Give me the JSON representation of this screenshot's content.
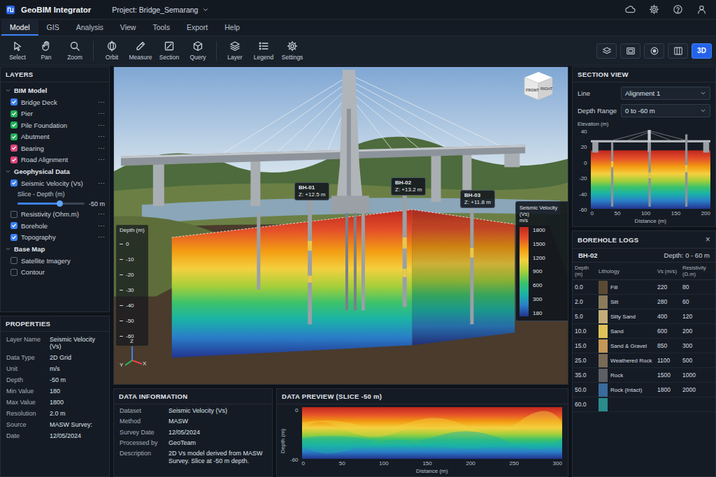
{
  "window": {
    "app_name": "GeoBIM Integrator",
    "project": "Project: Bridge_Semarang"
  },
  "menu": [
    {
      "label": "Model",
      "selected": true
    },
    {
      "label": "GIS",
      "selected": false
    },
    {
      "label": "Analysis",
      "selected": false
    },
    {
      "label": "View",
      "selected": false
    },
    {
      "label": "Tools",
      "selected": false
    },
    {
      "label": "Export",
      "selected": false
    },
    {
      "label": "Help",
      "selected": false
    }
  ],
  "toolbar": [
    [
      {
        "label": "Select",
        "kind": "select"
      },
      {
        "label": "Pan",
        "kind": "pan"
      },
      {
        "label": "Zoom",
        "kind": "zoom"
      }
    ],
    [
      {
        "label": "Orbit",
        "kind": "orbit"
      },
      {
        "label": "Measure",
        "kind": "measure"
      },
      {
        "label": "Section",
        "kind": "section"
      },
      {
        "label": "Query",
        "kind": "query"
      }
    ],
    [
      {
        "label": "Layer",
        "kind": "layer"
      },
      {
        "label": "Legend",
        "kind": "legend"
      },
      {
        "label": "Settings",
        "kind": "settings"
      }
    ]
  ],
  "view_modes": [
    {
      "kind": "layers",
      "selected": false
    },
    {
      "kind": "frame",
      "selected": false
    },
    {
      "kind": "target",
      "selected": false
    },
    {
      "kind": "split",
      "selected": false
    },
    {
      "kind": "text",
      "label": "3D",
      "selected": true
    }
  ],
  "layers": {
    "title": "LAYERS",
    "groups": [
      {
        "title": "BIM Model",
        "expanded": true,
        "items": [
          {
            "kind": "checkbox",
            "label": "Bridge Deck",
            "checked": true,
            "color": "#3b82f6",
            "more": "⋯"
          },
          {
            "kind": "checkbox",
            "label": "Pier",
            "checked": true,
            "color": "#22b05a",
            "more": "⋯"
          },
          {
            "kind": "checkbox",
            "label": "Pile Foundation",
            "checked": true,
            "color": "#22b05a",
            "more": "⋯"
          },
          {
            "kind": "checkbox",
            "label": "Abutment",
            "checked": true,
            "color": "#22b05a",
            "more": "⋯"
          },
          {
            "kind": "checkbox",
            "label": "Bearing",
            "checked": true,
            "color": "#e0457b",
            "more": "⋯"
          },
          {
            "kind": "checkbox",
            "label": "Road Alignment",
            "checked": true,
            "color": "#e0457b",
            "more": "⋯"
          }
        ]
      },
      {
        "title": "Geophysical Data",
        "expanded": true,
        "items": [
          {
            "kind": "checkbox",
            "label": "Seismic Velocity (Vs)",
            "checked": true,
            "color": "#3b82f6",
            "more": "⋯"
          },
          {
            "kind": "slider",
            "label": "Slice - Depth (m)",
            "level": 0.62,
            "reading": "-50 m"
          },
          {
            "kind": "checkbox",
            "label": "Resistivity (Ohm.m)",
            "checked": false,
            "more": "⋯"
          },
          {
            "kind": "checkbox",
            "label": "Borehole",
            "checked": true,
            "color": "#3b82f6",
            "more": "⋯"
          },
          {
            "kind": "checkbox",
            "label": "Topography",
            "checked": true,
            "color": "#3b82f6",
            "more": "⋯"
          }
        ]
      },
      {
        "title": "Base Map",
        "expanded": true,
        "items": [
          {
            "kind": "checkbox",
            "label": "Satellite Imagery",
            "checked": false
          },
          {
            "kind": "checkbox",
            "label": "Contour",
            "checked": false
          }
        ]
      }
    ]
  },
  "properties": {
    "title": "PROPERTIES",
    "rows": [
      [
        "Layer Name",
        "Seismic Velocity (Vs)"
      ],
      [
        "Data Type",
        "2D Grid"
      ],
      [
        "Unit",
        "m/s"
      ],
      [
        "Depth",
        "-50 m"
      ],
      [
        "Min Value",
        "180"
      ],
      [
        "Max Value",
        "1800"
      ],
      [
        "Resolution",
        "2.0 m"
      ],
      [
        "Source",
        "MASW Survey:"
      ],
      [
        "Date",
        "12/05/2024"
      ]
    ]
  },
  "viewport": {
    "boreholes": [
      {
        "name": "BH-01",
        "z": "Z: +12.5 m"
      },
      {
        "name": "BH-02",
        "z": "Z: +13.2 m"
      },
      {
        "name": "BH-03",
        "z": "Z: +11.8 m"
      }
    ],
    "depth_axis": {
      "title": "Depth (m)",
      "ticks": [
        "0",
        "-10",
        "-20",
        "-30",
        "-40",
        "-50",
        "-60"
      ]
    },
    "legend": {
      "title": "Seismic Velocity (Vs)",
      "unit": "m/s",
      "ticks": [
        "1800",
        "1500",
        "1200",
        "900",
        "600",
        "300",
        "180"
      ]
    },
    "view_cube": {
      "front": "FRONT",
      "right": "RIGHT"
    },
    "axes": {
      "z": "Z",
      "y": "Y",
      "x": "X"
    }
  },
  "data_information": {
    "title": "DATA INFORMATION",
    "rows": [
      [
        "Dataset",
        "Seismic Velocity (Vs)"
      ],
      [
        "Method",
        "MASW"
      ],
      [
        "Survey Date",
        "12/05/2024"
      ],
      [
        "Processed by",
        "GeoTeam"
      ],
      [
        "Description",
        "2D Vs model derived from MASW Survey. Slice at -50 m depth."
      ]
    ]
  },
  "data_preview": {
    "title": "DATA PREVIEW (SLICE -50 m)",
    "y_label": "Depth (m)",
    "y_ticks": [
      "0",
      "-60"
    ],
    "x_label": "Distance (m)",
    "x_ticks": [
      "0",
      "50",
      "100",
      "150",
      "200",
      "250",
      "300"
    ]
  },
  "section_view": {
    "title": "SECTION VIEW",
    "fields": [
      {
        "label": "Line",
        "value": "Alignment 1"
      },
      {
        "label": "Depth Range",
        "value": "0 to -60 m"
      }
    ],
    "y_label": "Elevation (m)",
    "y_ticks": [
      "40",
      "20",
      "0",
      "-20",
      "-40",
      "-60"
    ],
    "x_label": "Distance (m)",
    "x_ticks": [
      "0",
      "50",
      "100",
      "150",
      "200"
    ]
  },
  "borehole_logs": {
    "title": "BOREHOLE LOGS",
    "close": "×",
    "borehole": "BH-02",
    "depth": "Depth: 0 - 60 m",
    "columns": [
      "Depth (m)",
      "Lithology",
      "Vs (m/s)",
      "Resistivity (Ω.m)"
    ],
    "rows": [
      {
        "depth": "0.0",
        "lithology": "Fill",
        "vs": "220",
        "resistivity": "80",
        "color": "#5b4a33"
      },
      {
        "depth": "2.0",
        "lithology": "Silt",
        "vs": "280",
        "resistivity": "60",
        "color": "#8a7b5c"
      },
      {
        "depth": "5.0",
        "lithology": "Silty Sand",
        "vs": "400",
        "resistivity": "120",
        "color": "#c4ad78"
      },
      {
        "depth": "10.0",
        "lithology": "Sand",
        "vs": "600",
        "resistivity": "200",
        "color": "#e0c25a"
      },
      {
        "depth": "15.0",
        "lithology": "Sand & Gravel",
        "vs": "850",
        "resistivity": "300",
        "color": "#c49658"
      },
      {
        "depth": "25.0",
        "lithology": "Weathered Rock",
        "vs": "1100",
        "resistivity": "500",
        "color": "#7a6a58"
      },
      {
        "depth": "35.0",
        "lithology": "Rock",
        "vs": "1500",
        "resistivity": "1000",
        "color": "#5c5f63"
      },
      {
        "depth": "50.0",
        "lithology": "Rock (Intact)",
        "vs": "1800",
        "resistivity": "2000",
        "color": "#3b6a9c"
      },
      {
        "depth": "60.0",
        "lithology": "",
        "vs": "",
        "resistivity": "",
        "color": "#2a8c8c"
      }
    ]
  }
}
